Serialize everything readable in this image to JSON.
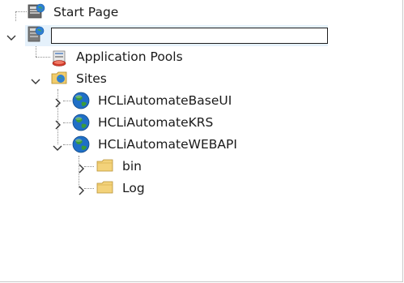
{
  "tree": {
    "start_page": {
      "label": "Start Page",
      "icon": "start-page-icon"
    },
    "server": {
      "name_value": "",
      "icon": "server-icon",
      "expanded": true
    },
    "app_pools": {
      "label": "Application Pools",
      "icon": "app-pools-icon"
    },
    "sites": {
      "label": "Sites",
      "icon": "sites-folder-icon",
      "expanded": true,
      "items": [
        {
          "label": "HCLiAutomateBaseUI",
          "expanded": false
        },
        {
          "label": "HCLiAutomateKRS",
          "expanded": false
        },
        {
          "label": "HCLiAutomateWEBAPI",
          "expanded": true,
          "children": [
            {
              "label": "bin"
            },
            {
              "label": "Log"
            }
          ]
        }
      ]
    }
  },
  "colors": {
    "globe_blue": "#1f6fc7",
    "globe_green": "#3a9c3a",
    "folder_yellow": "#f3d27a",
    "selection": "#e5f1fb"
  }
}
